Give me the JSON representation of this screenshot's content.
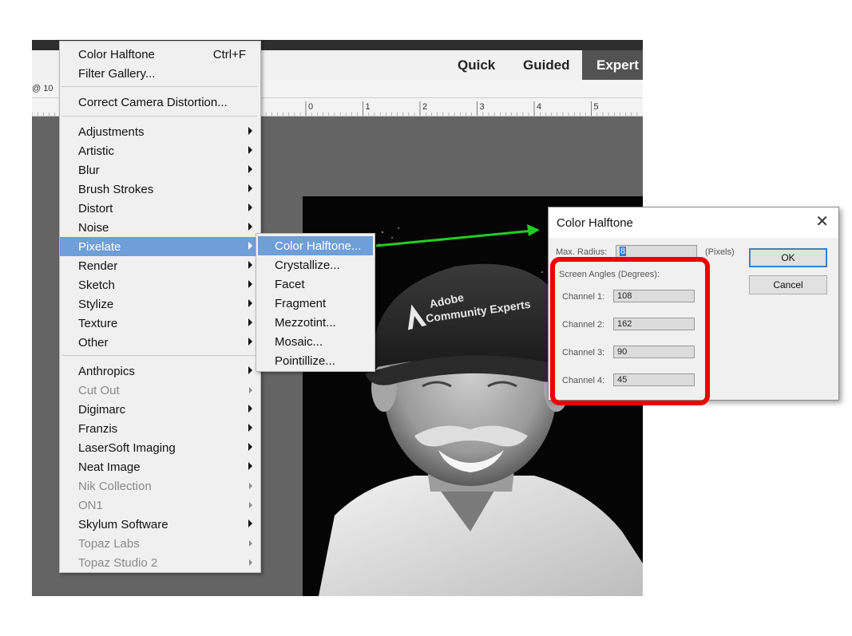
{
  "app": {
    "modes": [
      "Quick",
      "Guided",
      "Expert"
    ],
    "active_mode": "Expert",
    "doc_tab_label": "@ 10",
    "ruler_ticks": [
      "0",
      "1",
      "2",
      "3",
      "4",
      "5"
    ]
  },
  "filter_menu": {
    "groups": [
      [
        {
          "label": "Color Halftone",
          "shortcut": "Ctrl+F"
        },
        {
          "label": "Filter Gallery..."
        }
      ],
      [
        {
          "label": "Correct Camera Distortion..."
        }
      ],
      [
        {
          "label": "Adjustments",
          "submenu": true
        },
        {
          "label": "Artistic",
          "submenu": true
        },
        {
          "label": "Blur",
          "submenu": true
        },
        {
          "label": "Brush Strokes",
          "submenu": true
        },
        {
          "label": "Distort",
          "submenu": true
        },
        {
          "label": "Noise",
          "submenu": true
        },
        {
          "label": "Pixelate",
          "submenu": true,
          "highlighted": true
        },
        {
          "label": "Render",
          "submenu": true
        },
        {
          "label": "Sketch",
          "submenu": true
        },
        {
          "label": "Stylize",
          "submenu": true
        },
        {
          "label": "Texture",
          "submenu": true
        },
        {
          "label": "Other",
          "submenu": true
        }
      ],
      [
        {
          "label": "Anthropics",
          "submenu": true
        },
        {
          "label": "Cut Out",
          "submenu": true,
          "disabled": true
        },
        {
          "label": "Digimarc",
          "submenu": true
        },
        {
          "label": "Franzis",
          "submenu": true
        },
        {
          "label": "LaserSoft Imaging",
          "submenu": true
        },
        {
          "label": "Neat Image",
          "submenu": true
        },
        {
          "label": "Nik Collection",
          "submenu": true,
          "disabled": true
        },
        {
          "label": "ON1",
          "submenu": true,
          "disabled": true
        },
        {
          "label": "Skylum Software",
          "submenu": true
        },
        {
          "label": "Topaz Labs",
          "submenu": true,
          "disabled": true
        },
        {
          "label": "Topaz Studio 2",
          "submenu": true,
          "disabled": true
        }
      ]
    ]
  },
  "pixelate_submenu": [
    {
      "label": "Color Halftone...",
      "highlighted": true
    },
    {
      "label": "Crystallize..."
    },
    {
      "label": "Facet"
    },
    {
      "label": "Fragment"
    },
    {
      "label": "Mezzotint..."
    },
    {
      "label": "Mosaic..."
    },
    {
      "label": "Pointillize..."
    }
  ],
  "dialog": {
    "title": "Color Halftone",
    "max_radius_label": "Max. Radius:",
    "max_radius_value": "8",
    "max_radius_unit": "(Pixels)",
    "screen_angles_label": "Screen Angles (Degrees):",
    "channels": [
      {
        "label": "Channel 1:",
        "value": "108"
      },
      {
        "label": "Channel 2:",
        "value": "162"
      },
      {
        "label": "Channel 3:",
        "value": "90"
      },
      {
        "label": "Channel 4:",
        "value": "45"
      }
    ],
    "ok_label": "OK",
    "cancel_label": "Cancel"
  },
  "photo": {
    "cap_text_line1": "Adobe",
    "cap_text_line2": "Community Experts"
  },
  "colors": {
    "highlight": "#6f9ed8",
    "annotation_arrow": "#22cc22",
    "annotation_box": "#ee0000",
    "app_background": "#646464"
  }
}
